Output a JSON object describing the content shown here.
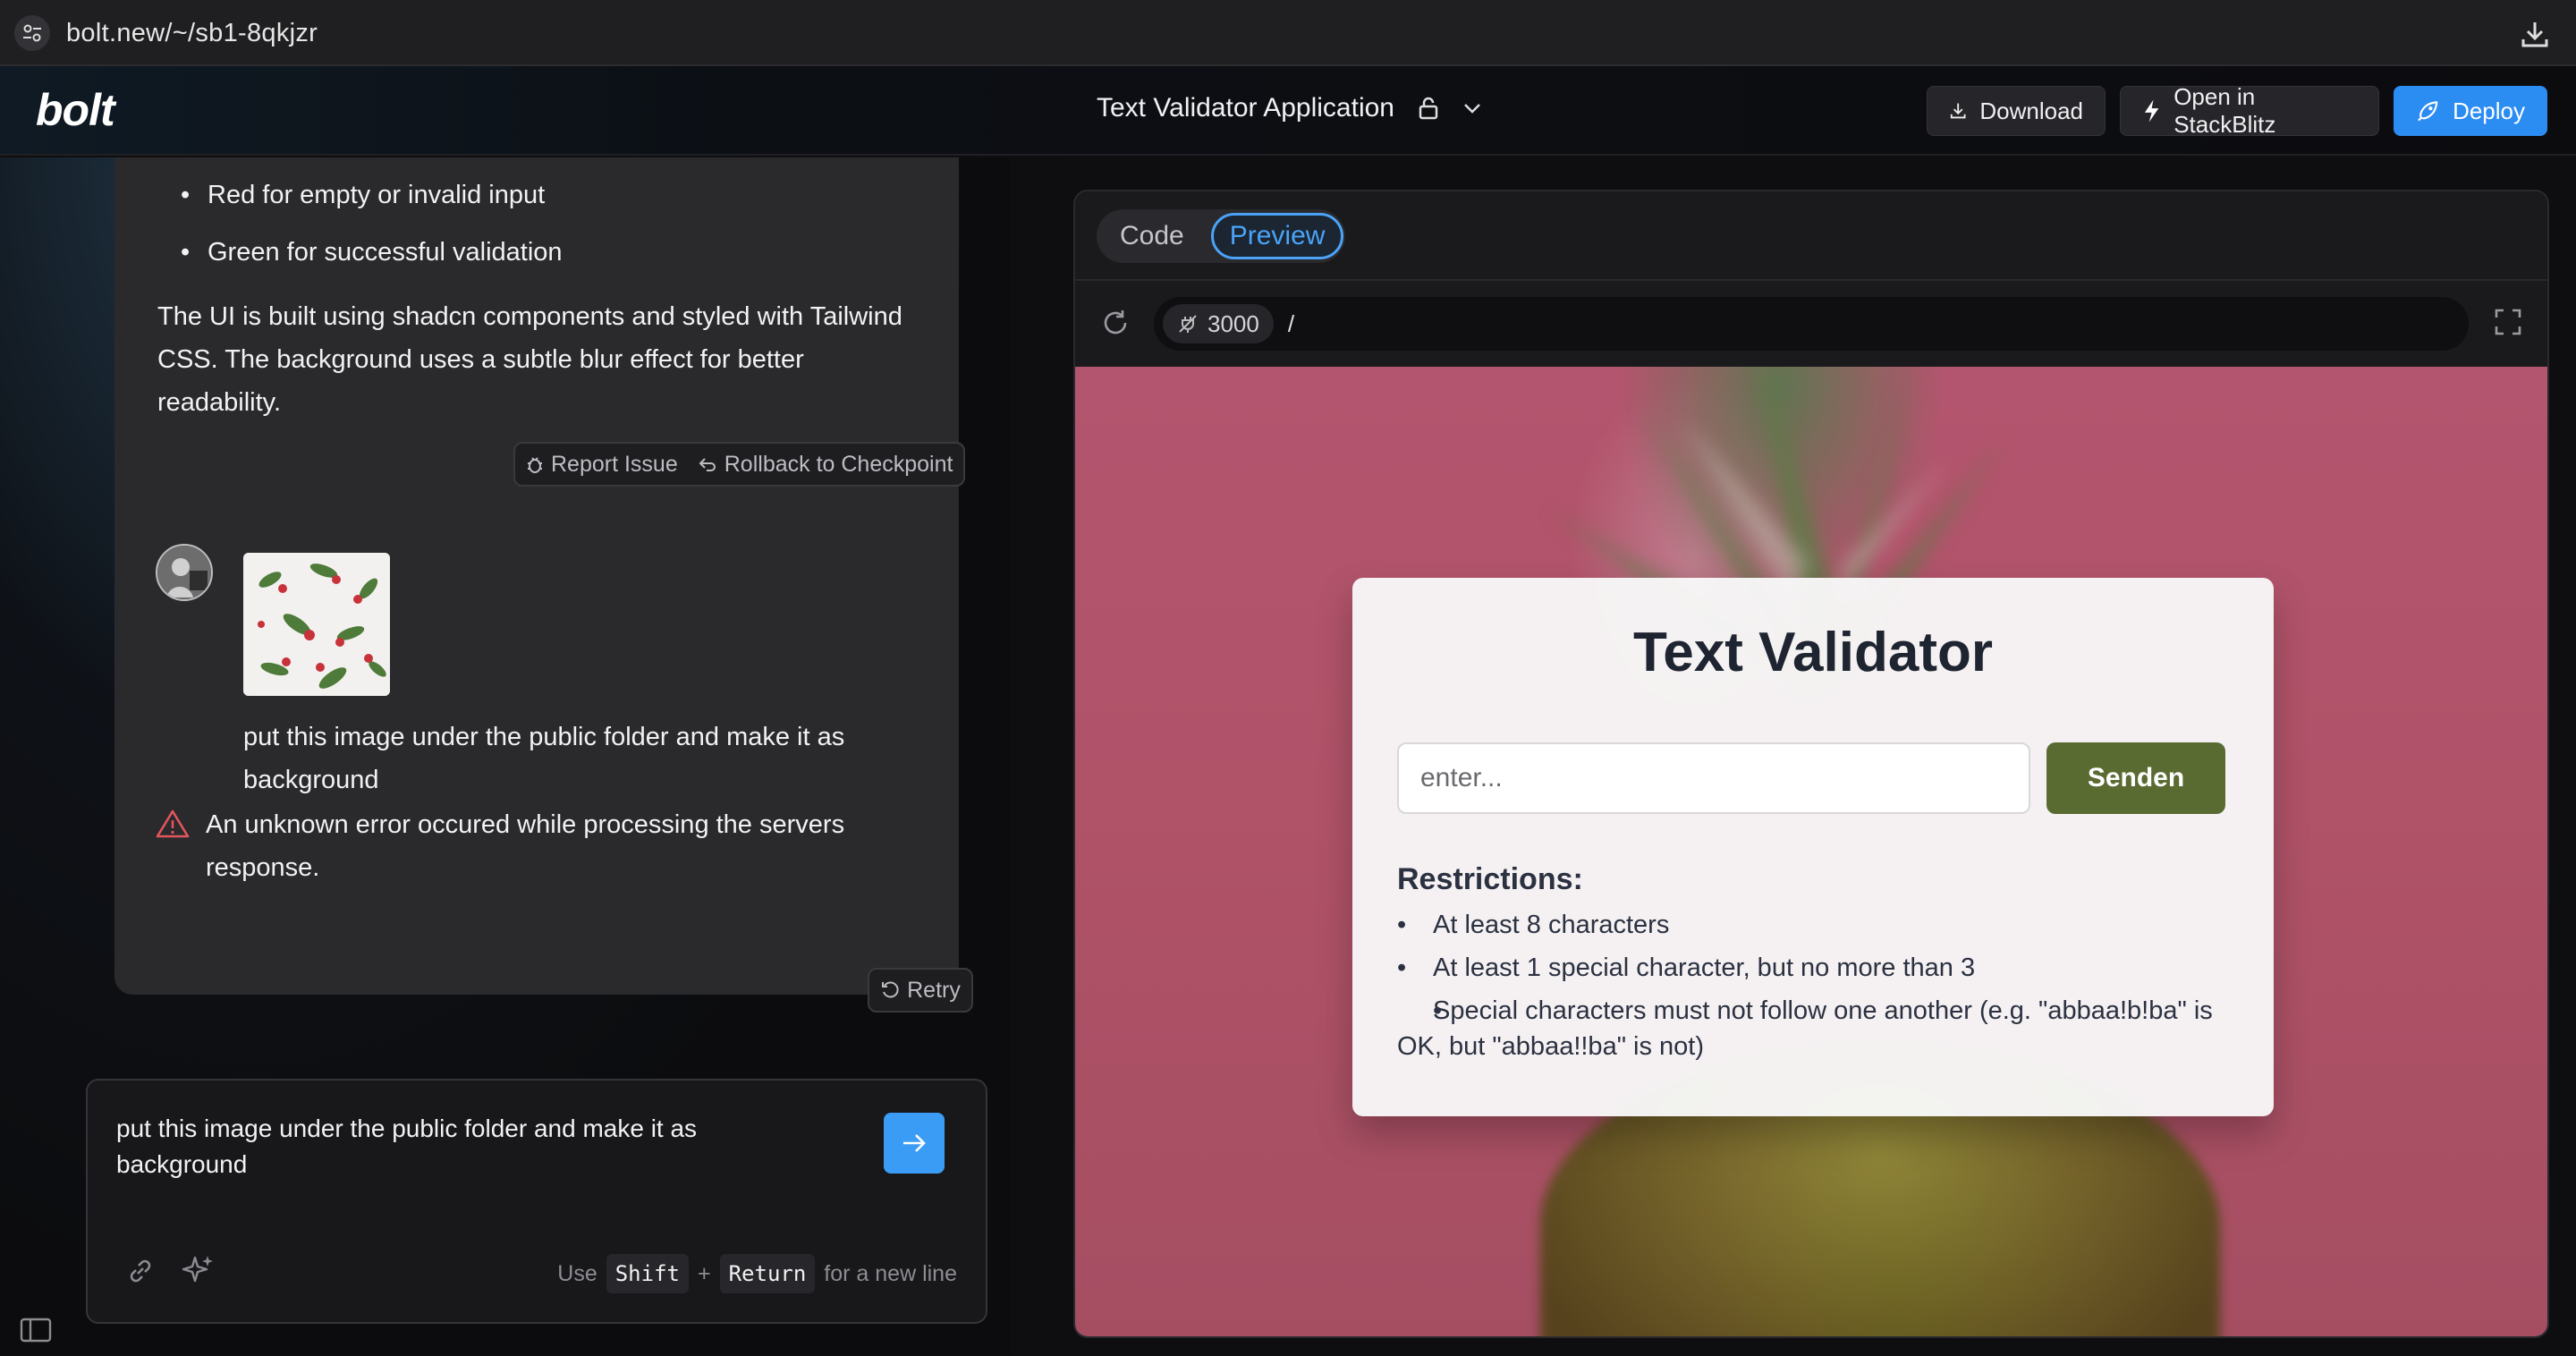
{
  "browser": {
    "url": "bolt.new/~/sb1-8qkjzr"
  },
  "header": {
    "logo": "bolt",
    "project_title": "Text Validator Application",
    "download_label": "Download",
    "stackblitz_label": "Open in StackBlitz",
    "deploy_label": "Deploy",
    "deploy_color": "#2b8cf2"
  },
  "chat": {
    "message1": {
      "bullets": [
        "Red for empty or invalid input",
        "Green for successful validation"
      ],
      "paragraph": "The UI is built using shadcn components and styled with Tailwind CSS. The background uses a subtle blur effect for better readability.",
      "report_label": "Report Issue",
      "rollback_label": "Rollback to Checkpoint"
    },
    "message2": {
      "text": "put this image under the public folder and make it as background",
      "error": "An unknown error occured while processing the servers response.",
      "retry_label": "Retry"
    },
    "input": {
      "value": "put this image under the public folder and make it as background",
      "hint_use": "Use",
      "hint_shift": "Shift",
      "hint_plus": "+",
      "hint_return": "Return",
      "hint_tail": "for a new line"
    }
  },
  "workbench": {
    "tabs": [
      "Code",
      "Preview"
    ],
    "active_tab": "Preview",
    "port": "3000",
    "path": "/"
  },
  "app_preview": {
    "title": "Text Validator",
    "input_placeholder": "enter...",
    "button_label": "Senden",
    "button_color": "#5a6b34",
    "restrictions_title": "Restrictions:",
    "restrictions": [
      "At least 8 characters",
      "At least 1 special character, but no more than 3",
      "Special characters must not follow one another (e.g. \"abbaa!b!ba\" is OK, but \"abbaa!!ba\" is not)"
    ]
  }
}
